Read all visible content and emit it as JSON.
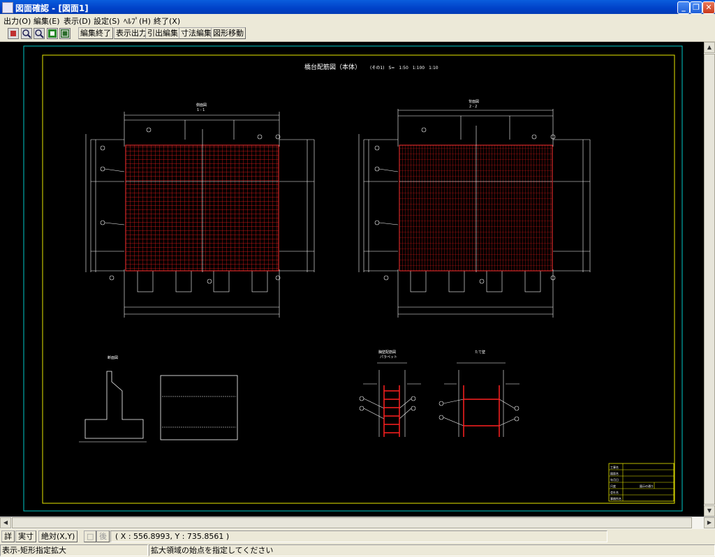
{
  "window": {
    "title": "図面確認 - [図面1]"
  },
  "menu": {
    "items": [
      "出力(O)",
      "編集(E)",
      "表示(D)",
      "設定(S)",
      "ﾍﾙﾌﾟ(H)",
      "終了(X)"
    ]
  },
  "toolbar": {
    "buttons": [
      "編集終了",
      "表示出力",
      "引出編集",
      "寸法編集",
      "図形移動"
    ],
    "icons": [
      "select-icon",
      "zoom-in-icon",
      "zoom-out-icon",
      "zoom-fit-icon",
      "zoom-window-icon"
    ]
  },
  "drawing": {
    "title": "橋台配筋図（本体）",
    "subtitle": "(その1)　S=　1:50　1:100　1:10",
    "view1_label": "側面図",
    "view1_sub": "1 - 1",
    "view2_label": "背面図",
    "view2_sub": "2 - 2",
    "detail1_label": "胸壁配筋図",
    "detail1_sub": "パラペット",
    "detail2_label": "たて壁",
    "section_label": "断面図"
  },
  "titleblock": {
    "rows": [
      "工事名",
      "図面名",
      "年月日",
      "尺度",
      "会社名",
      "事務所名"
    ],
    "scale_value": "図示の通り"
  },
  "bottom": {
    "buttons": [
      "詳",
      "実寸",
      "絶対(X,Y)",
      "□",
      "後"
    ],
    "coord": "( X : 556.8993, Y : 735.8561 )"
  },
  "status": {
    "mode": "表示-矩形指定拡大",
    "message": "拡大領域の始点を指定してください"
  },
  "colors": {
    "titlebar": "#0a5ddd",
    "canvas": "#000000",
    "rebar": "#ff0000",
    "frame_outer": "#00c8c8",
    "frame_inner": "#e8e800"
  }
}
